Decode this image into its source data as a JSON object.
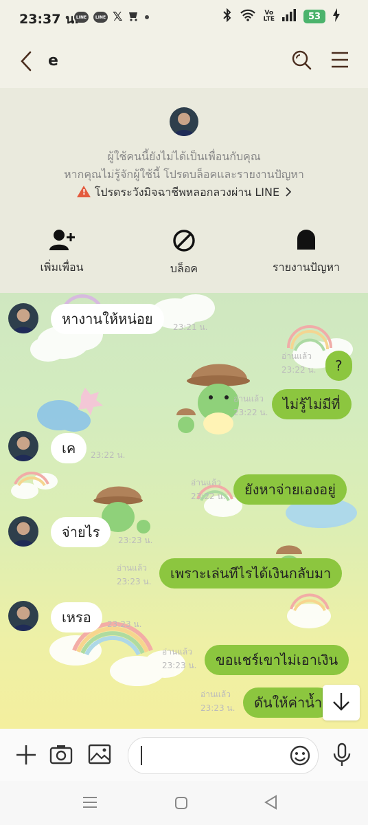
{
  "status_bar": {
    "time": "23:37 น.",
    "notif_line_1": "LINE",
    "notif_line_2": "LINE",
    "notif_x": "𝕏",
    "battery": "53",
    "volte_top": "Vo",
    "volte_bottom": "LTE"
  },
  "header": {
    "title": "e"
  },
  "info_panel": {
    "notice_line1": "ผู้ใช้คนนี้ยังไม่ได้เป็นเพื่อนกับคุณ",
    "notice_line2": "หากคุณไม่รู้จักผู้ใช้นี้ โปรดบล็อคและรายงานปัญหา",
    "warning": "โปรดระวังมิจฉาชีพหลอกลวงผ่าน LINE",
    "actions": [
      {
        "label": "เพิ่มเพื่อน",
        "icon": "add-friend-icon"
      },
      {
        "label": "บล็อค",
        "icon": "block-icon"
      },
      {
        "label": "รายงานปัญหา",
        "icon": "report-icon"
      }
    ]
  },
  "messages": [
    {
      "dir": "in",
      "text": "หางานให้หน่อย",
      "time": "23:21 น."
    },
    {
      "dir": "out",
      "text": "?",
      "read": "อ่านแล้ว",
      "time": "23:22 น."
    },
    {
      "dir": "out",
      "text": "ไม่รู้ไม่มีที่",
      "read": "อ่านแล้ว",
      "time": "23:22 น."
    },
    {
      "dir": "in",
      "text": "เค",
      "time": "23:22 น."
    },
    {
      "dir": "out",
      "text": "ยังหาจ่ายเองอยู่",
      "read": "อ่านแล้ว",
      "time": "23:22 น."
    },
    {
      "dir": "in",
      "text": "จ่ายไร",
      "time": "23:23 น."
    },
    {
      "dir": "out",
      "text": "เพราะเล่นทีไรได้เงินกลับมา",
      "read": "อ่านแล้ว",
      "time": "23:23 น."
    },
    {
      "dir": "in",
      "text": "เหรอ",
      "time": "23:23 น."
    },
    {
      "dir": "out",
      "text": "ขอแชร์เขาไม่เอาเงิน",
      "read": "อ่านแล้ว",
      "time": "23:23 น."
    },
    {
      "dir": "out",
      "text": "ดันให้ค่าน้ำ",
      "read": "อ่านแล้ว",
      "time": "23:23 น."
    }
  ],
  "composer": {
    "placeholder": ""
  },
  "colors": {
    "outgoing_bubble": "#8cc63f",
    "incoming_bubble": "#ffffff",
    "warning": "#e35b3e",
    "battery": "#4bb36c"
  }
}
